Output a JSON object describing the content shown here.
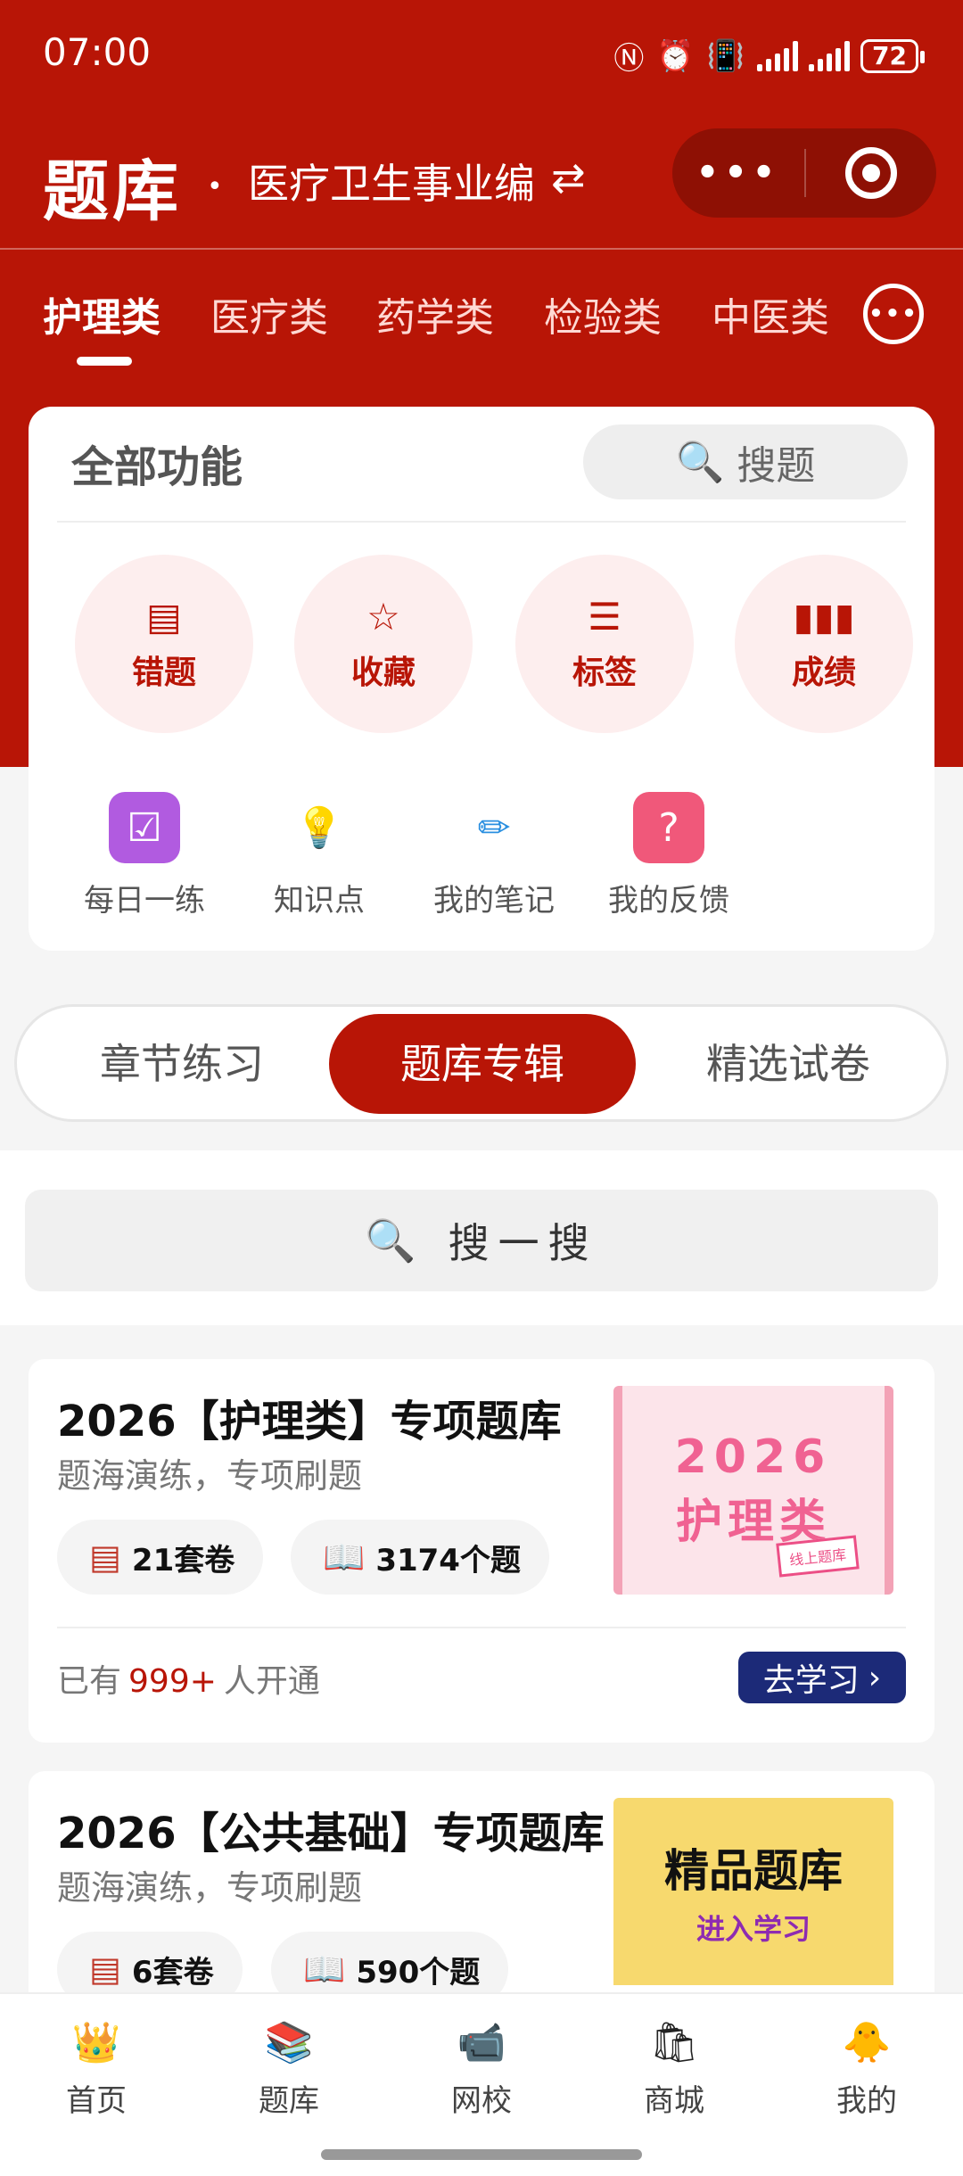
{
  "status": {
    "time": "07:00",
    "battery": "72"
  },
  "header": {
    "title": "题库",
    "dot": "•",
    "subtitle": "医疗卫生事业编"
  },
  "categories": [
    "护理类",
    "医疗类",
    "药学类",
    "检验类",
    "中医类"
  ],
  "functions": {
    "title": "全部功能",
    "search_label": "搜题",
    "primary": [
      "错题",
      "收藏",
      "标签",
      "成绩"
    ],
    "secondary": [
      "每日一练",
      "知识点",
      "我的笔记",
      "我的反馈"
    ]
  },
  "segments": [
    "章节练习",
    "题库专辑",
    "精选试卷"
  ],
  "search": {
    "label": "搜一搜"
  },
  "products": [
    {
      "title": "2026【护理类】专项题库",
      "subtitle": "题海演练，专项刷题",
      "sets": "21套卷",
      "questions": "3174个题",
      "count_prefix": "已有",
      "count_value": "999+",
      "count_suffix": "人开通",
      "button": "去学习",
      "cover_year": "2026",
      "cover_category": "护理类",
      "cover_tag": "线上题库"
    },
    {
      "title": "2026【公共基础】专项题库",
      "subtitle": "题海演练，专项刷题",
      "sets": "6套卷",
      "questions": "590个题",
      "cover_big": "精品题库",
      "cover_small": "进入学习"
    }
  ],
  "bottom_nav": [
    "首页",
    "题库",
    "网校",
    "商城",
    "我的"
  ],
  "colors": {
    "primary_red": "#b81506",
    "button_navy": "#1c2a78"
  }
}
